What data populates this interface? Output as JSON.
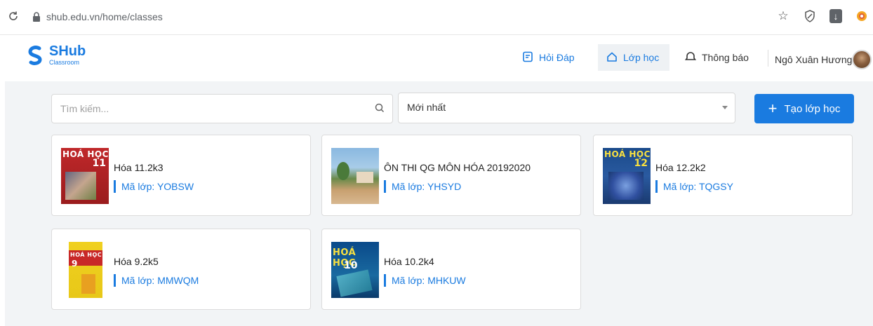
{
  "browser": {
    "url": "shub.edu.vn/home/classes"
  },
  "header": {
    "logo_title": "SHub",
    "logo_sub": "Classroom",
    "nav": {
      "qa": "Hỏi Đáp",
      "classes": "Lớp học",
      "notifications": "Thông báo"
    },
    "user_name": "Ngô Xuân Hương"
  },
  "toolbar": {
    "search_placeholder": "Tìm kiếm...",
    "sort_value": "Mới nhất",
    "create_label": "Tạo lớp học"
  },
  "classes": [
    {
      "title": "Hóa 11.2k3",
      "code": "Mã lớp: YOBSW",
      "thumb": "hoa-hoc-11-book-icon",
      "book_label": "HOÁ HỌC",
      "book_num": "11"
    },
    {
      "title": "ÔN THI QG MÔN HÓA 20192020",
      "code": "Mã lớp: YHSYD",
      "thumb": "school-photo-icon"
    },
    {
      "title": "Hóa 12.2k2",
      "code": "Mã lớp: TQGSY",
      "thumb": "hoa-hoc-12-book-icon",
      "book_label": "HOÁ HỌC",
      "book_num": "12"
    },
    {
      "title": "Hóa 9.2k5",
      "code": "Mã lớp: MMWQM",
      "thumb": "hoa-hoc-9-book-icon",
      "book_label": "HOÁ HỌC",
      "book_num": "9"
    },
    {
      "title": "Hóa 10.2k4",
      "code": "Mã lớp: MHKUW",
      "thumb": "hoa-hoc-10-book-icon",
      "book_label": "HOÁ HỌC",
      "book_num": "10"
    }
  ],
  "colors": {
    "accent": "#1a7be0",
    "background": "#f2f4f6"
  }
}
